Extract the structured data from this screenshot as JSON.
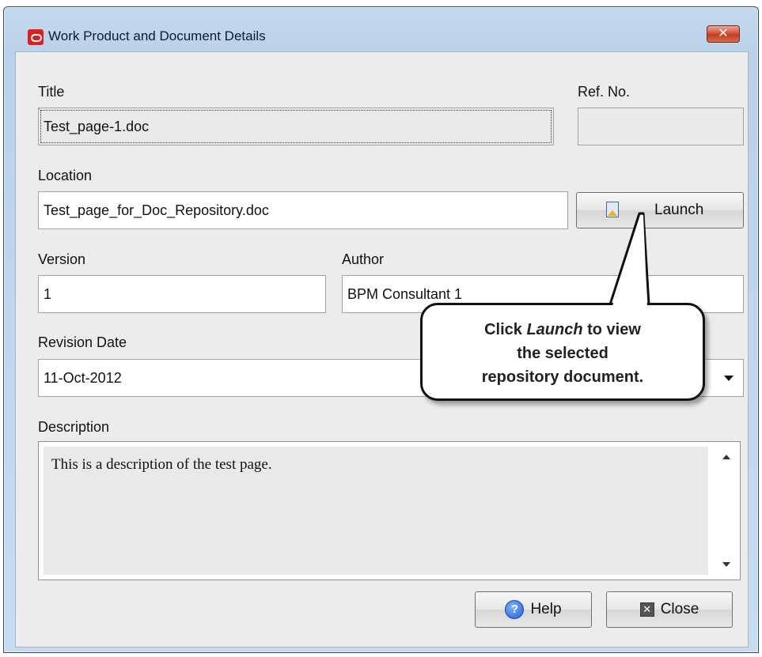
{
  "window": {
    "title": "Work Product and Document Details",
    "close_glyph": "✕"
  },
  "form": {
    "title_label": "Title",
    "title_value": "Test_page-1.doc",
    "ref_no_label": "Ref. No.",
    "ref_no_value": "",
    "location_label": "Location",
    "location_value": "Test_page_for_Doc_Repository.doc",
    "launch_label": "Launch",
    "version_label": "Version",
    "version_value": "1",
    "author_label": "Author",
    "author_value": "BPM Consultant 1",
    "revision_date_label": "Revision Date",
    "revision_date_value": "11-Oct-2012",
    "description_label": "Description",
    "description_value": "This is a description of the test page."
  },
  "footer": {
    "help_label": "Help",
    "close_label": "Close"
  },
  "callout": {
    "text_prefix": "Click ",
    "text_emphasis": "Launch",
    "text_line1_suffix": " to view",
    "text_line2": "the selected",
    "text_line3": "repository document."
  },
  "icons": {
    "app": "oracle-logo-icon",
    "help": "?",
    "close": "✕"
  },
  "colors": {
    "window_frame": "#b9d1ea",
    "close_button": "#c23d23",
    "app_icon": "#e01e1e",
    "help_icon": "#1f5fd1"
  }
}
